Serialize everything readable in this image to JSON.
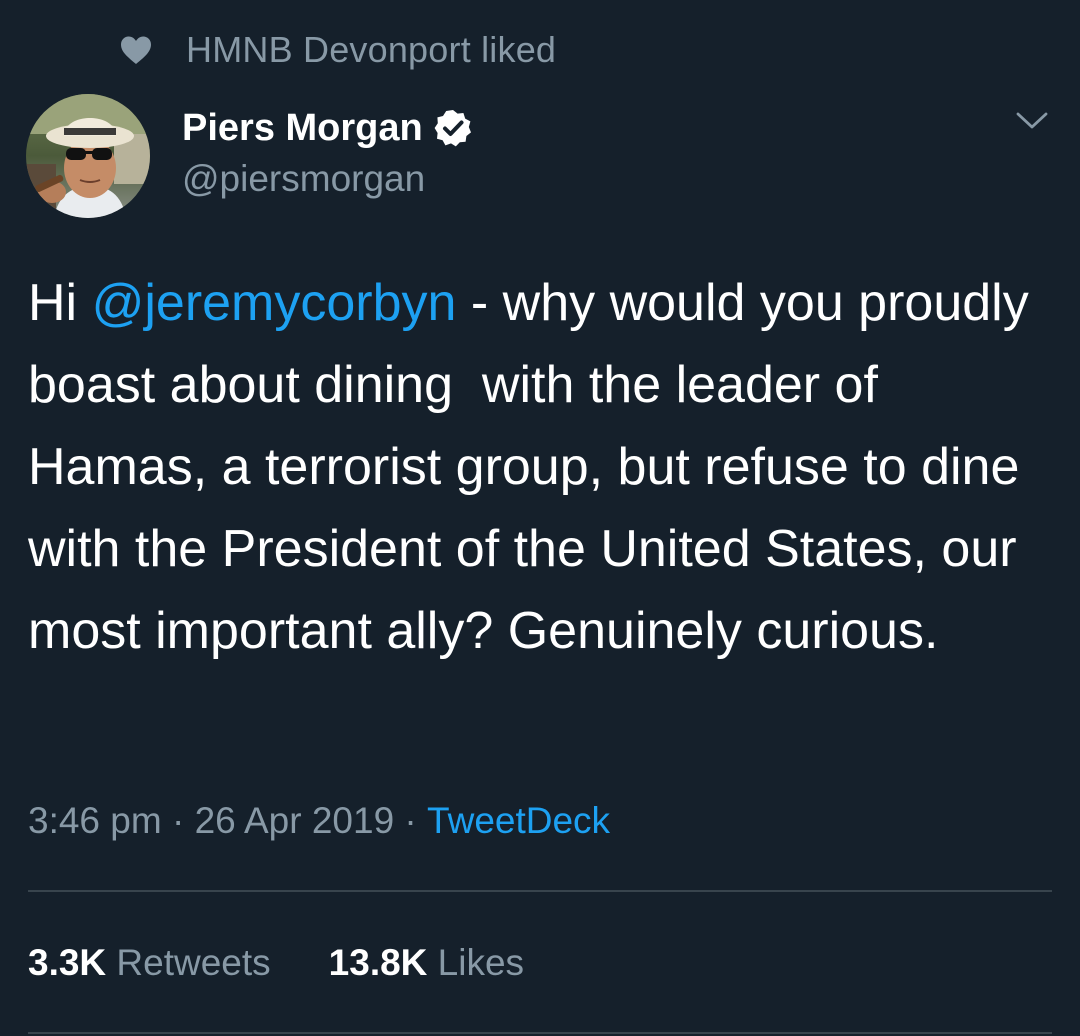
{
  "social_context": {
    "icon": "heart-icon",
    "text": "HMNB Devonport liked"
  },
  "author": {
    "display_name": "Piers Morgan",
    "handle": "@piersmorgan",
    "verified_icon": "verified-badge-icon"
  },
  "tweet": {
    "text_before": "Hi ",
    "mention": "@jeremycorbyn",
    "text_after": " - why would you proudly boast about dining  with the leader of Hamas, a terrorist group, but refuse to dine with the President of the United States, our most important ally? Genuinely curious."
  },
  "meta": {
    "time": "3:46 pm",
    "separator": " · ",
    "date": "26 Apr 2019",
    "separator2": " · ",
    "source": "TweetDeck"
  },
  "stats": {
    "retweets_count": "3.3K",
    "retweets_label": " Retweets",
    "likes_count": "13.8K",
    "likes_label": " Likes"
  },
  "colors": {
    "background": "#15202b",
    "secondary_text": "#8899a6",
    "link": "#1da1f2",
    "divider": "#38444d"
  }
}
